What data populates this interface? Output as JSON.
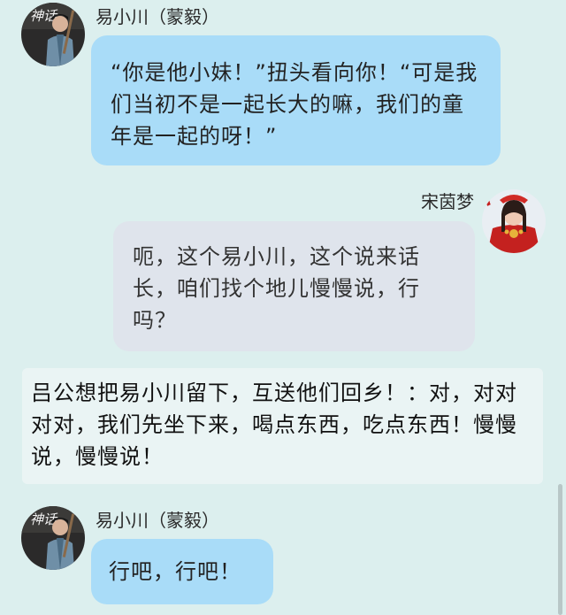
{
  "messages": [
    {
      "speaker": "易小川（蒙毅）",
      "text": "“你是他小妹！”扭头看向你！“可是我们当初不是一起长大的嘛，我们的童年是一起的呀！”"
    },
    {
      "speaker": "宋茵梦",
      "text": "呃，这个易小川，这个说来话长，咱们找个地儿慢慢说，行吗？"
    },
    {
      "text": "吕公想把易小川留下，互送他们回乡！：对，对对对对，我们先坐下来，喝点东西，吃点东西！慢慢说，慢慢说！"
    },
    {
      "speaker": "易小川（蒙毅）",
      "text": "行吧，行吧！"
    }
  ],
  "avatars": {
    "yixiaochuan_logo_text": "神话"
  },
  "colors": {
    "background": "#dcefee",
    "bubble_blue": "#a9dcf8",
    "bubble_gray": "#dfe4ec",
    "narration_bg": "#eaf4f4"
  }
}
